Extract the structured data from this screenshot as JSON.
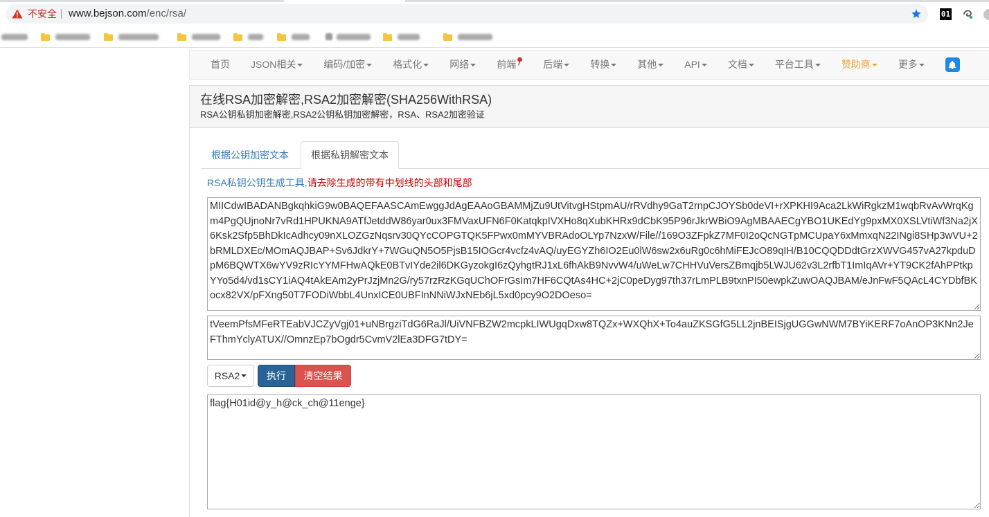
{
  "browser": {
    "security_label": "不安全",
    "url_host": "www.bejson.com",
    "url_path": "/enc/rsa/",
    "extension_badge": "01"
  },
  "nav": {
    "items": [
      {
        "label": "首页",
        "dropdown": false
      },
      {
        "label": "JSON相关",
        "dropdown": true
      },
      {
        "label": "编码/加密",
        "dropdown": true
      },
      {
        "label": "格式化",
        "dropdown": true
      },
      {
        "label": "网络",
        "dropdown": true
      },
      {
        "label": "前端",
        "dropdown": false
      },
      {
        "label": "后端",
        "dropdown": true
      },
      {
        "label": "转换",
        "dropdown": true
      },
      {
        "label": "其他",
        "dropdown": true
      },
      {
        "label": "API",
        "dropdown": true
      },
      {
        "label": "文档",
        "dropdown": true
      },
      {
        "label": "平台工具",
        "dropdown": true
      },
      {
        "label": "赞助商",
        "dropdown": true
      },
      {
        "label": "更多",
        "dropdown": true
      }
    ]
  },
  "panel": {
    "title": "在线RSA加密解密,RSA2加密解密(SHA256WithRSA)",
    "subtitle": "RSA公钥私钥加密解密,RSA2公钥私钥加密解密，RSA、RSA2加密验证"
  },
  "tabs": [
    {
      "label": "根据公钥加密文本",
      "active": false
    },
    {
      "label": "根据私钥解密文本",
      "active": true
    }
  ],
  "tool_note": {
    "link_text": "RSA私钥公钥生成工具,",
    "warning_text": "请去除生成的带有中划线的头部和尾部"
  },
  "form": {
    "private_key": "MIICdwIBADANBgkqhkiG9w0BAQEFAASCAmEwggJdAgEAAoGBAMMjZu9UtVitvgHStpmAU/rRVdhy9GaT2rnpCJOYSb0deVI+rXPKHI9Aca2LkWiRgkzM1wqbRvAvWrqKgm4PgQUjnoNr7vRd1HPUKNA9ATfJetddW86yar0ux3FMVaxUFN6F0KatqkpIVXHo8qXubKHRx9dCbK95P96rJkrWBiO9AgMBAAECgYBO1UKEdYg9pxMX0XSLVtiWf3Na2jX6Ksk2Sfp5BhDkIcAdhcy09nXLOZGzNqsrv30QYcCOPGTQK5FPwx0mMYVBRAdoOLYp7NzxW/File//169O3ZFpkZ7MF0I2oQcNGTpMCUpaY6xMmxqN22INgi8SHp3wVU+2bRMLDXEc/MOmAQJBAP+Sv6JdkrY+7WGuQN5O5PjsB15IOGcr4vcfz4vAQ/uyEGYZh6IO2Eu0lW6sw2x6uRg0c6hMiFEJcO89qIH/B10CQQDDdtGrzXWVG457vA27kpduDpM6BQWTX6wYV9zRIcYYMFHwAQkE0BTvIYde2il6DKGyzokgI6zQyhgtRJ1xL6fhAkB9NvvW4/uWeLw7CHHVuVersZBmqjb5LWJU62v3L2rfbT1ImIqAVr+YT9CK2fAhPPtkpYYo5d4/vd1sCY1iAQ4tAkEAm2yPrJzjMn2G/ry57rzRzKGqUChOFrGsIm7HF6CQtAs4HC+2jC0peDyg97th37rLmPLB9txnPI50ewpkZuwOAQJBAM/eJnFwF5QAcL4CYDbfBKocx82VX/pFXng50T7FODiWbbL4UnxICE0UBFInNNiWJxNEb6jL5xd0pcy9O2DOeso=",
    "ciphertext": "tVeemPfsMFeRTEabVJCZyVgj01+uNBrgziTdG6RaJl/UiVNFBZW2mcpkLIWUgqDxw8TQZx+WXQhX+To4auZKSGfG5LL2jnBEISjgUGGwNWM7BYiKERF7oAnOP3KNn2JeFThmYclyATUX//OmnzEp7bOgdr5CvmV2lEa3DFG7tDY=",
    "algorithm": "RSA2",
    "execute_label": "执行",
    "clear_label": "清空结果",
    "result": "flag{H01id@y_h@ck_ch@11enge}"
  },
  "icons": {
    "security": "warning-icon",
    "bookmark_page": "star-icon",
    "bookmark_folder": "folder-icon",
    "frontend_badge": "pin-icon",
    "notifications": "bell-icon",
    "dropdown": "caret-down-icon"
  },
  "colors": {
    "link": "#337ab7",
    "warning_text": "#cc0000",
    "execute_button": "#2a6496",
    "clear_button": "#d9534f",
    "sponsor": "#eea236",
    "bell": "#1e88e5",
    "insecure": "#c5221f"
  }
}
